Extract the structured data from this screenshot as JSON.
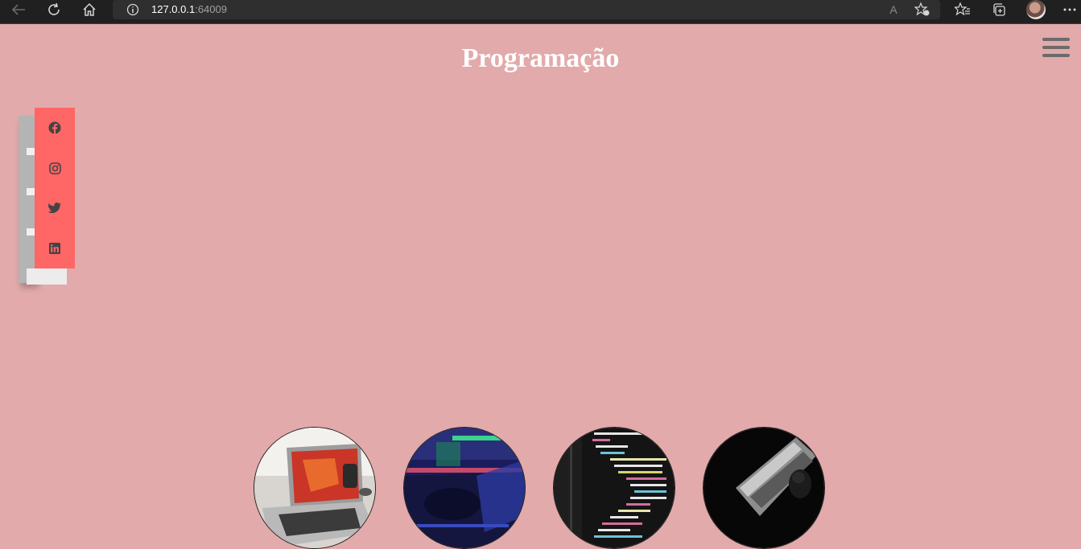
{
  "browser": {
    "url_host": "127.0.0.1",
    "url_port": ":64009",
    "icons": [
      "back-icon",
      "reload-icon",
      "home-icon",
      "info-icon",
      "read-aloud-icon",
      "add-favorite-icon",
      "favorites-icon",
      "collections-icon",
      "profile-avatar",
      "more-icon"
    ],
    "read_aloud_glyph": "A"
  },
  "page": {
    "title": "Programação",
    "background": "#e2aaaa",
    "menu_icon": "hamburger-icon"
  },
  "social": {
    "bar_color": "#ff6666",
    "icon_color": "#444444",
    "items": [
      {
        "icon": "facebook-icon"
      },
      {
        "icon": "instagram-icon"
      },
      {
        "icon": "twitter-icon"
      },
      {
        "icon": "linkedin-icon"
      }
    ]
  },
  "gallery": {
    "images": [
      {
        "name": "laptop-photo",
        "colors": [
          "#e9e6e1",
          "#c6342a"
        ]
      },
      {
        "name": "neon-keyboard-photo",
        "colors": [
          "#1d1f6b",
          "#3ad38c"
        ]
      },
      {
        "name": "code-screen-photo",
        "colors": [
          "#161616",
          "#d6d36c"
        ]
      },
      {
        "name": "hacker-laptop-photo",
        "colors": [
          "#0a0a0a",
          "#9a9a9a"
        ]
      }
    ]
  }
}
